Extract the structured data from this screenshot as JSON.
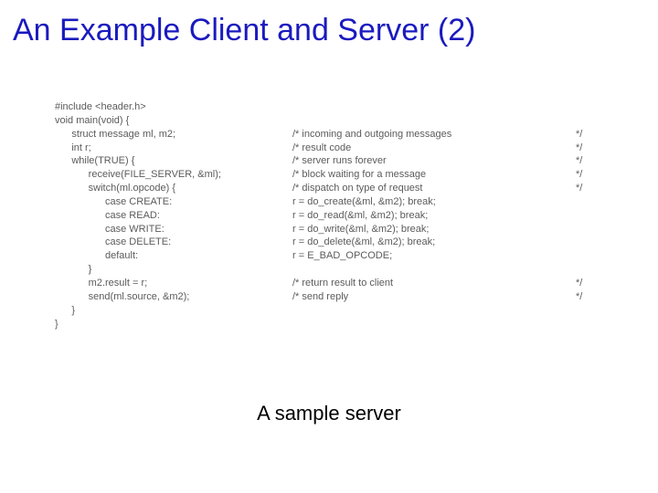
{
  "title": "An Example Client and Server (2)",
  "caption": "A sample server",
  "code": {
    "rows": [
      {
        "c": "#include <header.h>",
        "m": "",
        "e": ""
      },
      {
        "c": "void main(void) {",
        "m": "",
        "e": ""
      },
      {
        "c": "      struct message ml, m2;",
        "m": "/* incoming and outgoing messages",
        "e": "*/"
      },
      {
        "c": "      int r;",
        "m": "/* result code",
        "e": "*/"
      },
      {
        "c": "",
        "m": "",
        "e": ""
      },
      {
        "c": "      while(TRUE) {",
        "m": "/* server runs forever",
        "e": "*/"
      },
      {
        "c": "            receive(FILE_SERVER, &ml);",
        "m": "/* block waiting for a message",
        "e": "*/"
      },
      {
        "c": "            switch(ml.opcode) {",
        "m": "/* dispatch on type of request",
        "e": "*/"
      },
      {
        "c": "                  case CREATE:",
        "m": "r = do_create(&ml, &m2); break;",
        "e": ""
      },
      {
        "c": "                  case READ:",
        "m": "r = do_read(&ml, &m2); break;",
        "e": ""
      },
      {
        "c": "                  case WRITE:",
        "m": "r = do_write(&ml, &m2); break;",
        "e": ""
      },
      {
        "c": "                  case DELETE:",
        "m": "r = do_delete(&ml, &m2); break;",
        "e": ""
      },
      {
        "c": "                  default:",
        "m": "r = E_BAD_OPCODE;",
        "e": ""
      },
      {
        "c": "            }",
        "m": "",
        "e": ""
      },
      {
        "c": "            m2.result = r;",
        "m": "/* return result to client",
        "e": "*/"
      },
      {
        "c": "            send(ml.source, &m2);",
        "m": "/* send reply",
        "e": "*/"
      },
      {
        "c": "      }",
        "m": "",
        "e": ""
      },
      {
        "c": "}",
        "m": "",
        "e": ""
      }
    ]
  }
}
